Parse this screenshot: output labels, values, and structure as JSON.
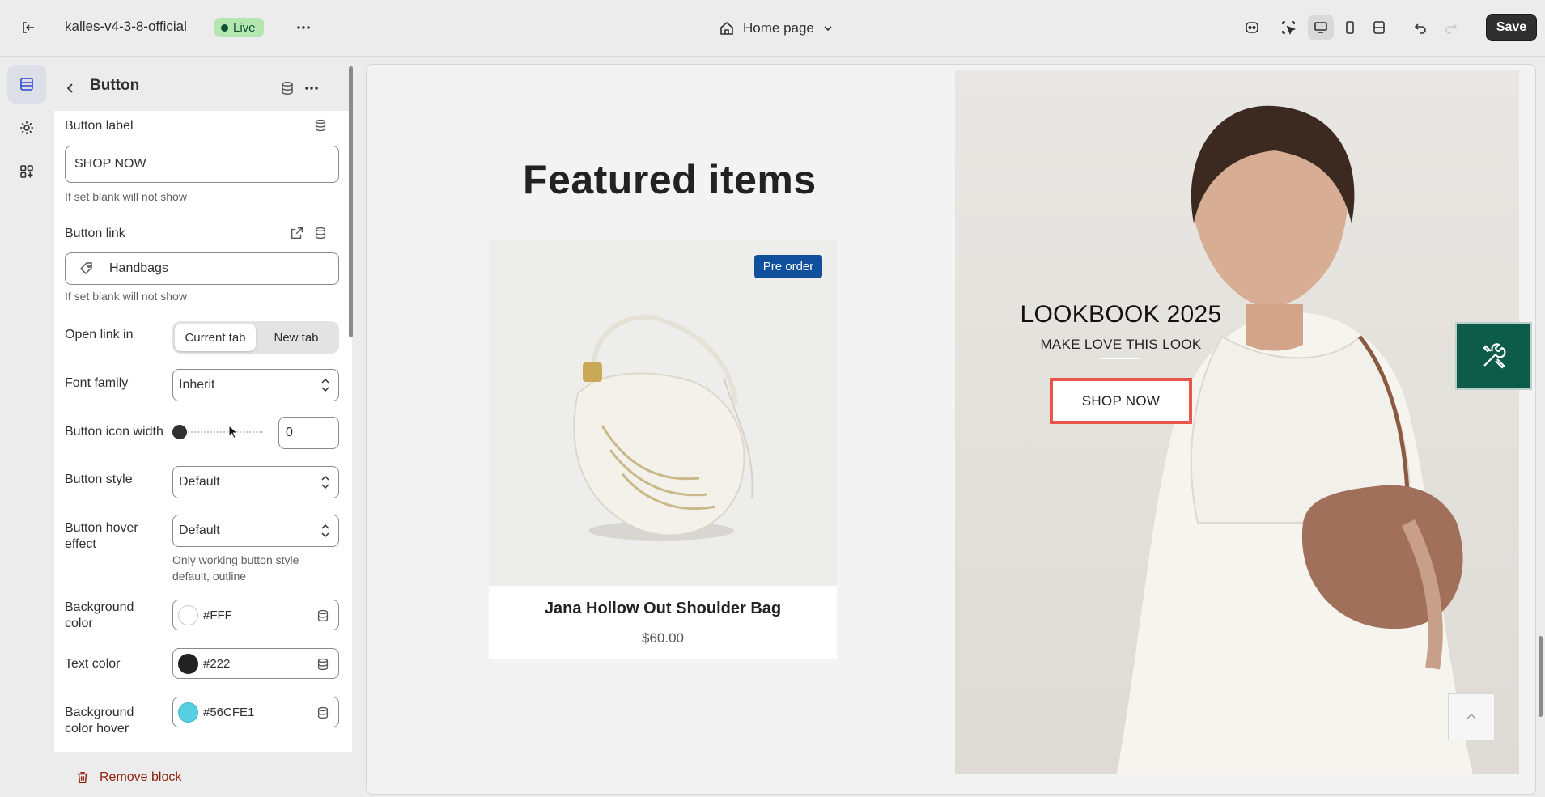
{
  "topbar": {
    "store_name": "kalles-v4-3-8-official",
    "status_badge": "Live",
    "page_selector": "Home page",
    "save_label": "Save"
  },
  "panel": {
    "title": "Button",
    "button_label": {
      "label": "Button label",
      "value": "SHOP NOW",
      "hint": "If set blank will not show"
    },
    "button_link": {
      "label": "Button link",
      "value": "Handbags",
      "hint": "If set blank will not show"
    },
    "open_link_in": {
      "label": "Open link in",
      "options": [
        "Current tab",
        "New tab"
      ],
      "selected": "Current tab"
    },
    "font_family": {
      "label": "Font family",
      "value": "Inherit"
    },
    "button_icon_width": {
      "label": "Button icon width",
      "value": "0"
    },
    "button_style": {
      "label": "Button style",
      "value": "Default"
    },
    "button_hover_effect": {
      "label": "Button hover effect",
      "value": "Default",
      "hint": "Only working button style default, outline"
    },
    "background_color": {
      "label": "Background color",
      "value": "#FFF",
      "swatch": "#ffffff"
    },
    "text_color": {
      "label": "Text color",
      "value": "#222",
      "swatch": "#222222"
    },
    "background_color_hover": {
      "label": "Background color hover",
      "value": "#56CFE1",
      "swatch": "#56cfe1"
    },
    "remove_label": "Remove block"
  },
  "preview": {
    "featured_title": "Featured items",
    "product": {
      "badge": "Pre order",
      "name": "Jana Hollow Out Shoulder Bag",
      "price": "$60.00"
    },
    "lookbook": {
      "title": "LOOKBOOK 2025",
      "subtitle": "MAKE LOVE THIS LOOK",
      "button": "SHOP NOW"
    }
  }
}
